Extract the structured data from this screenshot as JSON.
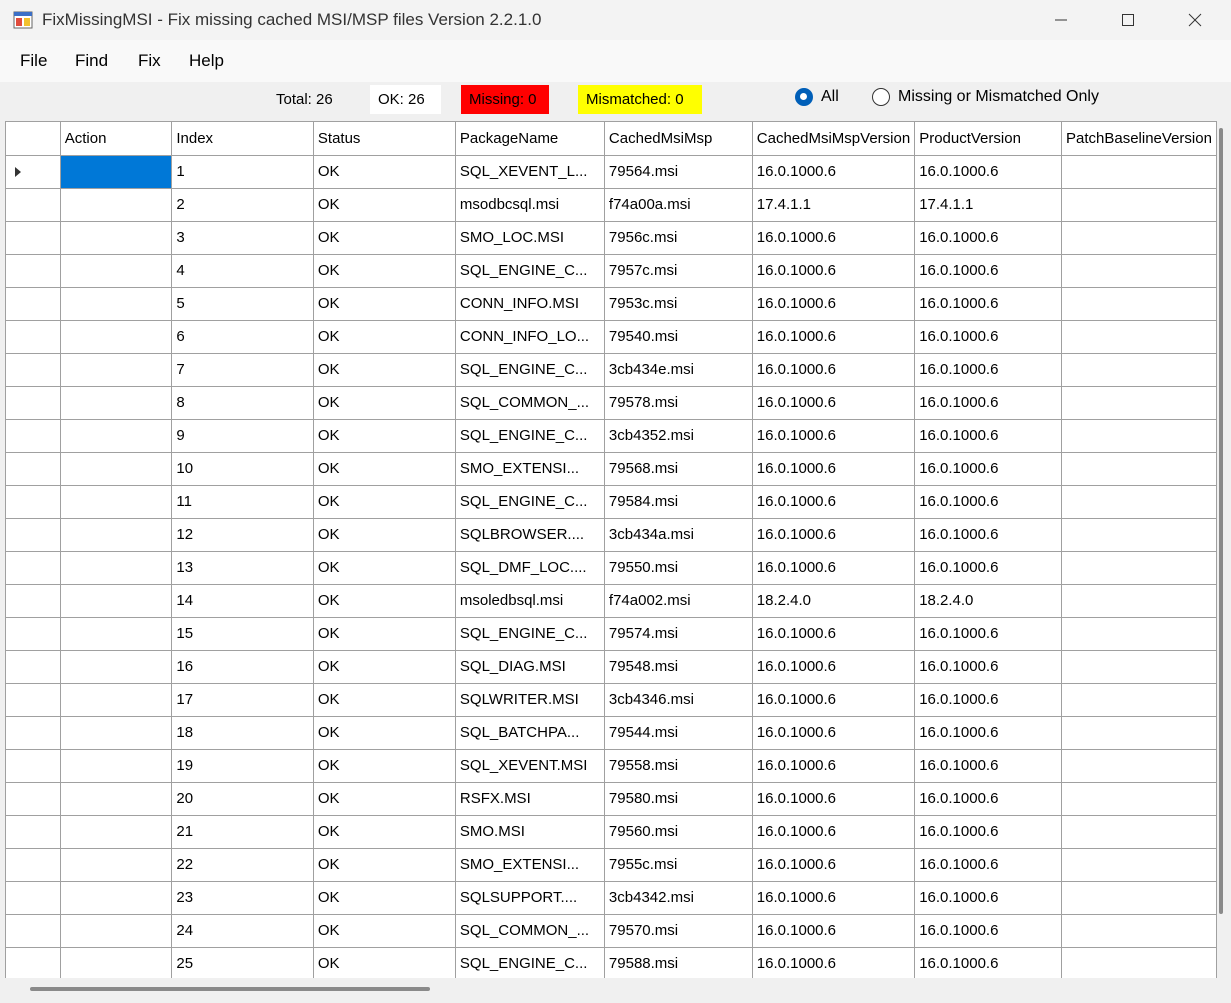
{
  "window": {
    "title": "FixMissingMSI - Fix missing cached MSI/MSP files  Version 2.2.1.0",
    "icon": "app-icon",
    "controls": [
      "minimize-icon",
      "maximize-icon",
      "close-icon"
    ]
  },
  "menu": {
    "items": [
      "File",
      "Find",
      "Fix",
      "Help"
    ]
  },
  "summary": {
    "total": "Total: 26",
    "ok": "OK: 26",
    "missing": "Missing: 0",
    "mismatched": "Mismatched: 0",
    "colors": {
      "missing": "#ff0000",
      "mismatched": "#ffff00",
      "ok": "#ffffff"
    }
  },
  "filter": {
    "options": [
      "All",
      "Missing or Mismatched Only"
    ],
    "selected": "All"
  },
  "grid": {
    "columns": [
      "Action",
      "Index",
      "Status",
      "PackageName",
      "CachedMsiMsp",
      "CachedMsiMspVersion",
      "ProductVersion",
      "PatchBaselineVersion"
    ],
    "rows": [
      [
        "",
        "1",
        "OK",
        "SQL_XEVENT_L...",
        "79564.msi",
        "16.0.1000.6",
        "16.0.1000.6",
        ""
      ],
      [
        "",
        "2",
        "OK",
        "msodbcsql.msi",
        "f74a00a.msi",
        "17.4.1.1",
        "17.4.1.1",
        ""
      ],
      [
        "",
        "3",
        "OK",
        "SMO_LOC.MSI",
        "7956c.msi",
        "16.0.1000.6",
        "16.0.1000.6",
        ""
      ],
      [
        "",
        "4",
        "OK",
        "SQL_ENGINE_C...",
        "7957c.msi",
        "16.0.1000.6",
        "16.0.1000.6",
        ""
      ],
      [
        "",
        "5",
        "OK",
        "CONN_INFO.MSI",
        "7953c.msi",
        "16.0.1000.6",
        "16.0.1000.6",
        ""
      ],
      [
        "",
        "6",
        "OK",
        "CONN_INFO_LO...",
        "79540.msi",
        "16.0.1000.6",
        "16.0.1000.6",
        ""
      ],
      [
        "",
        "7",
        "OK",
        "SQL_ENGINE_C...",
        "3cb434e.msi",
        "16.0.1000.6",
        "16.0.1000.6",
        ""
      ],
      [
        "",
        "8",
        "OK",
        "SQL_COMMON_...",
        "79578.msi",
        "16.0.1000.6",
        "16.0.1000.6",
        ""
      ],
      [
        "",
        "9",
        "OK",
        "SQL_ENGINE_C...",
        "3cb4352.msi",
        "16.0.1000.6",
        "16.0.1000.6",
        ""
      ],
      [
        "",
        "10",
        "OK",
        "SMO_EXTENSI...",
        "79568.msi",
        "16.0.1000.6",
        "16.0.1000.6",
        ""
      ],
      [
        "",
        "11",
        "OK",
        "SQL_ENGINE_C...",
        "79584.msi",
        "16.0.1000.6",
        "16.0.1000.6",
        ""
      ],
      [
        "",
        "12",
        "OK",
        "SQLBROWSER....",
        "3cb434a.msi",
        "16.0.1000.6",
        "16.0.1000.6",
        ""
      ],
      [
        "",
        "13",
        "OK",
        "SQL_DMF_LOC....",
        "79550.msi",
        "16.0.1000.6",
        "16.0.1000.6",
        ""
      ],
      [
        "",
        "14",
        "OK",
        "msoledbsql.msi",
        "f74a002.msi",
        "18.2.4.0",
        "18.2.4.0",
        ""
      ],
      [
        "",
        "15",
        "OK",
        "SQL_ENGINE_C...",
        "79574.msi",
        "16.0.1000.6",
        "16.0.1000.6",
        ""
      ],
      [
        "",
        "16",
        "OK",
        "SQL_DIAG.MSI",
        "79548.msi",
        "16.0.1000.6",
        "16.0.1000.6",
        ""
      ],
      [
        "",
        "17",
        "OK",
        "SQLWRITER.MSI",
        "3cb4346.msi",
        "16.0.1000.6",
        "16.0.1000.6",
        ""
      ],
      [
        "",
        "18",
        "OK",
        "SQL_BATCHPA...",
        "79544.msi",
        "16.0.1000.6",
        "16.0.1000.6",
        ""
      ],
      [
        "",
        "19",
        "OK",
        "SQL_XEVENT.MSI",
        "79558.msi",
        "16.0.1000.6",
        "16.0.1000.6",
        ""
      ],
      [
        "",
        "20",
        "OK",
        "RSFX.MSI",
        "79580.msi",
        "16.0.1000.6",
        "16.0.1000.6",
        ""
      ],
      [
        "",
        "21",
        "OK",
        "SMO.MSI",
        "79560.msi",
        "16.0.1000.6",
        "16.0.1000.6",
        ""
      ],
      [
        "",
        "22",
        "OK",
        "SMO_EXTENSI...",
        "7955c.msi",
        "16.0.1000.6",
        "16.0.1000.6",
        ""
      ],
      [
        "",
        "23",
        "OK",
        "SQLSUPPORT....",
        "3cb4342.msi",
        "16.0.1000.6",
        "16.0.1000.6",
        ""
      ],
      [
        "",
        "24",
        "OK",
        "SQL_COMMON_...",
        "79570.msi",
        "16.0.1000.6",
        "16.0.1000.6",
        ""
      ],
      [
        "",
        "25",
        "OK",
        "SQL_ENGINE_C...",
        "79588.msi",
        "16.0.1000.6",
        "16.0.1000.6",
        ""
      ]
    ],
    "selected_row": 0,
    "selected_col": 0
  }
}
